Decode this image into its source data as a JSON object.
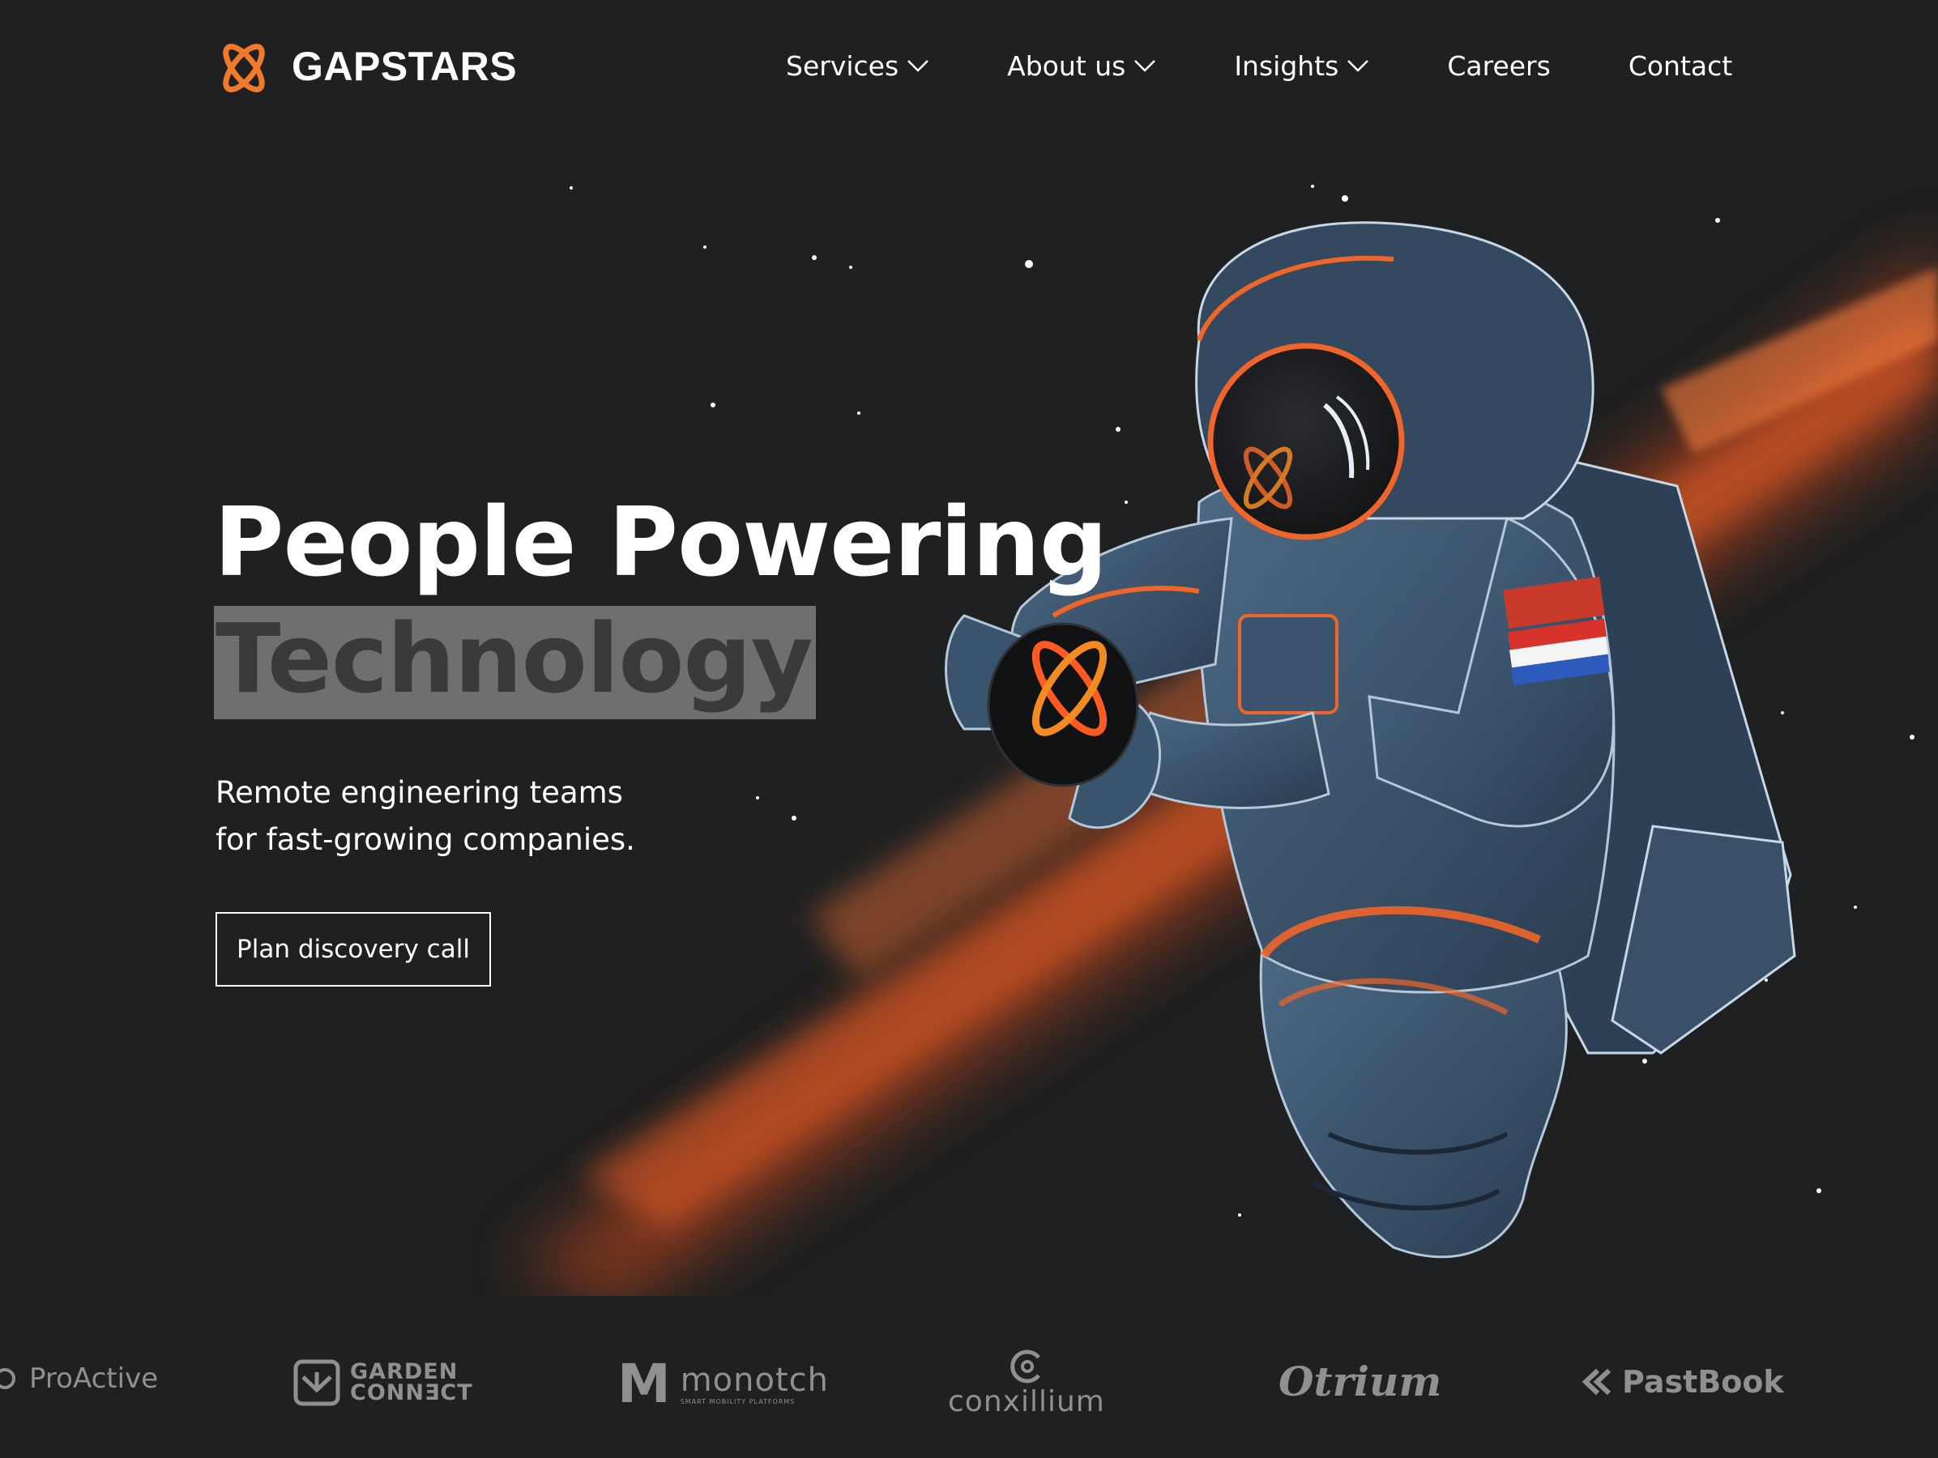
{
  "brand": {
    "name": "GAPSTARS",
    "accent_color": "#f07a2a",
    "background_color": "#1f2021"
  },
  "nav": {
    "items": [
      {
        "label": "Services",
        "has_dropdown": true
      },
      {
        "label": "About us",
        "has_dropdown": true
      },
      {
        "label": "Insights",
        "has_dropdown": true
      },
      {
        "label": "Careers",
        "has_dropdown": false
      },
      {
        "label": "Contact",
        "has_dropdown": false
      }
    ]
  },
  "hero": {
    "headline_line1": "People Powering",
    "headline_line2": "Technology",
    "subtitle_line1": "Remote engineering teams",
    "subtitle_line2": "for fast-growing companies.",
    "cta_label": "Plan discovery call",
    "illustration": "astronaut-with-orange-nebula"
  },
  "clients": {
    "proactive": "ProActive",
    "garden_line1": "GARDEN",
    "garden_line2": "CONNƎCT",
    "monotch_initial": "M",
    "monotch_name": "monotch",
    "monotch_tagline": "SMART MOBILITY PLATFORMS",
    "conxillium": "conxillium",
    "otrium": "Otrium",
    "pastbook": "PastBook"
  }
}
